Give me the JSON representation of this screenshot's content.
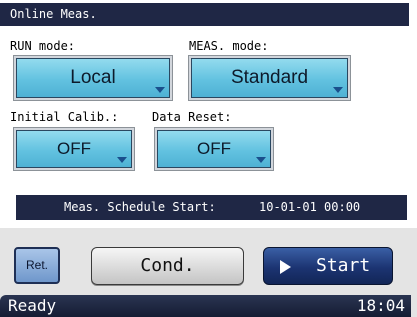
{
  "title": "Online Meas.",
  "run_mode": {
    "label": "RUN mode:",
    "value": "Local"
  },
  "meas_mode": {
    "label": "MEAS. mode:",
    "value": "Standard"
  },
  "initial_calib": {
    "label": "Initial Calib.:",
    "value": "OFF"
  },
  "data_reset": {
    "label": "Data Reset:",
    "value": "OFF"
  },
  "schedule": {
    "label": "Meas. Schedule Start:",
    "value": "10-01-01 00:00"
  },
  "buttons": {
    "ret": "Ret.",
    "cond": "Cond.",
    "start": "Start"
  },
  "status": {
    "text": "Ready",
    "time": "18:04"
  },
  "icons": {
    "dropdown": "chevron-down-icon",
    "play": "play-icon"
  },
  "colors": {
    "header": "#1f2745",
    "select": "#62c2e0",
    "start": "#1c3472"
  }
}
